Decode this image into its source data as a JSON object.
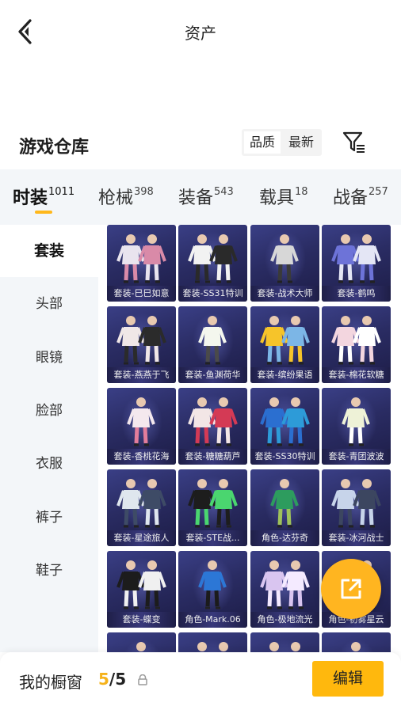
{
  "header": {
    "title": "资产"
  },
  "warehouse": {
    "title": "游戏仓库",
    "sort_quality": "品质",
    "sort_newest": "最新"
  },
  "tabs": [
    {
      "label": "时装",
      "count": "1011"
    },
    {
      "label": "枪械",
      "count": "398"
    },
    {
      "label": "装备",
      "count": "543"
    },
    {
      "label": "载具",
      "count": "18"
    },
    {
      "label": "战备",
      "count": "257"
    }
  ],
  "sidebar": {
    "items": [
      "套装",
      "头部",
      "眼镜",
      "脸部",
      "衣服",
      "裤子",
      "鞋子"
    ]
  },
  "items": [
    "套装-巳巳如意",
    "套装-SS31特训",
    "套装-战术大师",
    "套装-鹤鸣",
    "套装-燕燕于飞",
    "套装-鱼渊荷华",
    "套装-缤纷果语",
    "套装-棉花软糖",
    "套装-香桃花海",
    "套装-糖糖葫芦",
    "套装-SS30特训",
    "套装-青团波波",
    "套装-星途旅人",
    "套装-STE战...",
    "角色-达芬奇",
    "套装-冰河战士",
    "套装-蝶变",
    "角色-Mark.06",
    "角色-极地流光",
    "角色-初雾星云"
  ],
  "showcase": {
    "title": "我的橱窗",
    "current": "5",
    "total": "/5",
    "edit_label": "编辑"
  },
  "colors": {
    "accent": "#ffb81c",
    "card_bg": "#2a2c63"
  }
}
